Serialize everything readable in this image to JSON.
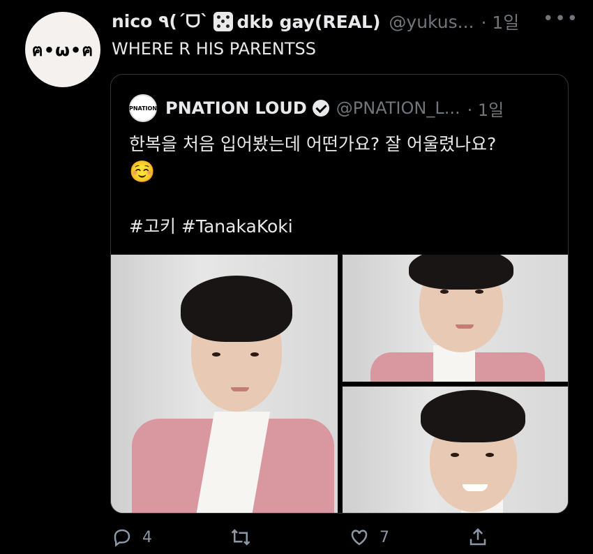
{
  "tweet": {
    "avatar_text": "ฅ•ω•ฅ",
    "display_name_part1": "nico ٩(ˊᗜˋ",
    "display_name_part2": "dkb gay(REAL)",
    "handle": "@yukus...",
    "time": "· 1일",
    "text": "WHERE R HIS PARENTSS"
  },
  "quote": {
    "avatar_text": "PNATION",
    "name": "PNATION LOUD",
    "handle": "@PNATION_L...",
    "time": "· 1일",
    "text": "한복을 처음 입어봤는데 어떤가요? 잘 어울렸나요?",
    "emoji": "☺️",
    "hashtags": "#고키 #TanakaKoki"
  },
  "actions": {
    "replies": "4",
    "likes": "7"
  },
  "colors": {
    "background": "#000000",
    "text": "#e7e9ea",
    "muted": "#71767b",
    "border": "#333639"
  }
}
